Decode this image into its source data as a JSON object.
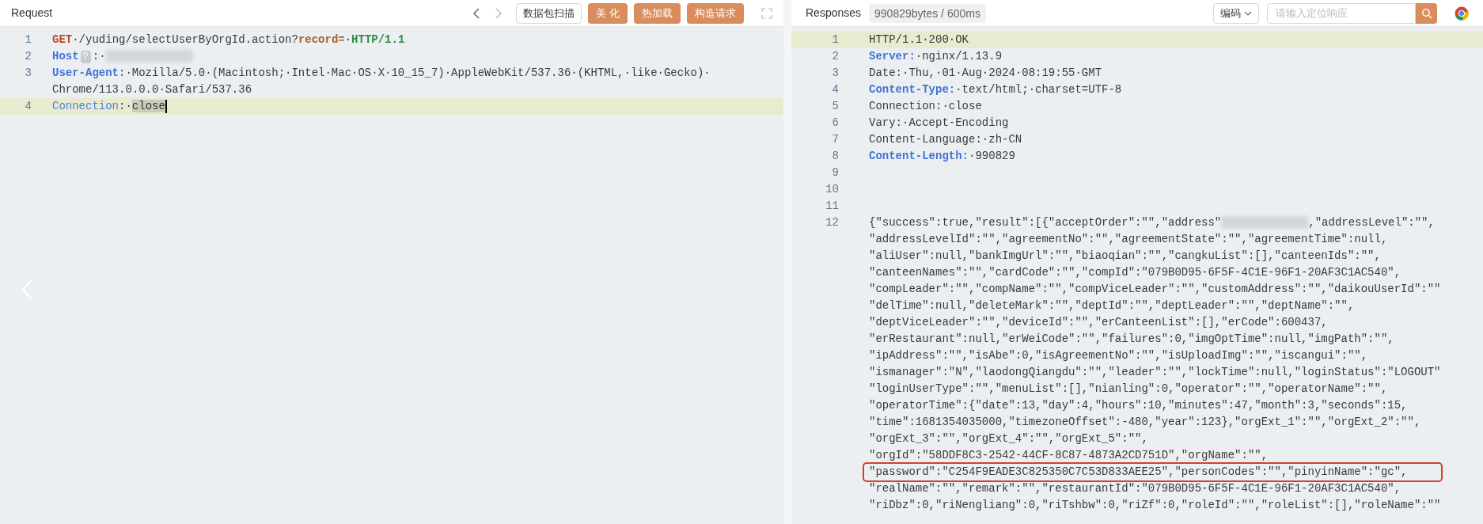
{
  "request": {
    "title": "Request",
    "buttons": [
      {
        "label": "数据包扫描",
        "kind": "outline"
      },
      {
        "label": "美 化",
        "kind": "primary"
      },
      {
        "label": "热加载",
        "kind": "primary"
      },
      {
        "label": "构造请求",
        "kind": "primary"
      }
    ],
    "lines": [
      {
        "number": "1",
        "current": false,
        "rows": [
          {
            "segments": [
              {
                "text": "GET",
                "kind": "method"
              },
              {
                "text": "·/yuding/selectUserByOrgId.action?",
                "kind": "plain"
              },
              {
                "text": "record=",
                "kind": "param"
              },
              {
                "text": "·",
                "kind": "plain"
              },
              {
                "text": "HTTP/1.1",
                "kind": "version"
              }
            ]
          }
        ]
      },
      {
        "number": "2",
        "current": false,
        "rows": [
          {
            "segments": [
              {
                "text": "Host",
                "kind": "key"
              },
              {
                "text": "?",
                "kind": "badge"
              },
              {
                "text": ":·",
                "kind": "plain"
              },
              {
                "kind": "redacted"
              }
            ]
          }
        ]
      },
      {
        "number": "3",
        "current": false,
        "rows": [
          {
            "segments": [
              {
                "text": "User-Agent",
                "kind": "key"
              },
              {
                "text": ":·Mozilla/5.0·(Macintosh;·Intel·Mac·OS·X·10_15_7)·AppleWebKit/537.36·(KHTML,·like·Gecko)·",
                "kind": "plain"
              }
            ]
          },
          {
            "segments": [
              {
                "text": "Chrome/113.0.0.0·Safari/537.36",
                "kind": "plain"
              }
            ]
          }
        ]
      },
      {
        "number": "4",
        "current": true,
        "rows": [
          {
            "segments": [
              {
                "text": "Connection",
                "kind": "keylight"
              },
              {
                "text": ":·",
                "kind": "plain"
              },
              {
                "text": "close",
                "kind": "selected"
              },
              {
                "kind": "cursor"
              }
            ]
          }
        ]
      }
    ]
  },
  "response": {
    "title": "Responses",
    "stats": "990829bytes / 600ms",
    "encoding": "编码",
    "search": {
      "placeholder": "请输入定位响应"
    },
    "lines": [
      {
        "number": "1",
        "current": true,
        "rows": [
          {
            "segments": [
              {
                "text": "HTTP/1.1·200·OK",
                "kind": "plain"
              }
            ]
          }
        ]
      },
      {
        "number": "2",
        "current": false,
        "rows": [
          {
            "segments": [
              {
                "text": "Server:",
                "kind": "key"
              },
              {
                "text": "·nginx/1.13.9",
                "kind": "plain"
              }
            ]
          }
        ]
      },
      {
        "number": "3",
        "current": false,
        "rows": [
          {
            "segments": [
              {
                "text": "Date:·Thu,·01·Aug·2024·08:19:55·GMT",
                "kind": "plain"
              }
            ]
          }
        ]
      },
      {
        "number": "4",
        "current": false,
        "rows": [
          {
            "segments": [
              {
                "text": "Content-Type:",
                "kind": "key"
              },
              {
                "text": "·text/html;·charset=UTF-8",
                "kind": "plain"
              }
            ]
          }
        ]
      },
      {
        "number": "5",
        "current": false,
        "rows": [
          {
            "segments": [
              {
                "text": "Connection:·close",
                "kind": "plain"
              }
            ]
          }
        ]
      },
      {
        "number": "6",
        "current": false,
        "rows": [
          {
            "segments": [
              {
                "text": "Vary:·Accept-Encoding",
                "kind": "plain"
              }
            ]
          }
        ]
      },
      {
        "number": "7",
        "current": false,
        "rows": [
          {
            "segments": [
              {
                "text": "Content-Language:·zh-CN",
                "kind": "plain"
              }
            ]
          }
        ]
      },
      {
        "number": "8",
        "current": false,
        "rows": [
          {
            "segments": [
              {
                "text": "Content-Length:",
                "kind": "key"
              },
              {
                "text": "·990829",
                "kind": "plain"
              }
            ]
          }
        ]
      },
      {
        "number": "9",
        "current": false,
        "rows": [
          {
            "segments": []
          }
        ]
      },
      {
        "number": "10",
        "current": false,
        "rows": [
          {
            "segments": []
          }
        ]
      },
      {
        "number": "11",
        "current": false,
        "rows": [
          {
            "segments": []
          }
        ]
      },
      {
        "number": "12",
        "current": false,
        "rows": [
          {
            "boxed": false,
            "segments": [
              {
                "text": "{\"success\":true,\"result\":[{\"acceptOrder\":\"\",\"address\"",
                "kind": "plain"
              },
              {
                "kind": "redacted"
              },
              {
                "text": ",\"addressLevel\":\"\",",
                "kind": "plain"
              }
            ]
          },
          {
            "boxed": false,
            "segments": [
              {
                "text": "\"addressLevelId\":\"\",\"agreementNo\":\"\",\"agreementState\":\"\",\"agreementTime\":null,",
                "kind": "plain"
              }
            ]
          },
          {
            "boxed": false,
            "segments": [
              {
                "text": "\"aliUser\":null,\"bankImgUrl\":\"\",\"biaoqian\":\"\",\"cangkuList\":[],\"canteenIds\":\"\",",
                "kind": "plain"
              }
            ]
          },
          {
            "boxed": false,
            "segments": [
              {
                "text": "\"canteenNames\":\"\",\"cardCode\":\"\",\"compId\":\"079B0D95-6F5F-4C1E-96F1-20AF3C1AC540\",",
                "kind": "plain"
              }
            ]
          },
          {
            "boxed": false,
            "segments": [
              {
                "text": "\"compLeader\":\"\",\"compName\":\"\",\"compViceLeader\":\"\",\"customAddress\":\"\",\"daikouUserId\":\"\"",
                "kind": "plain"
              }
            ]
          },
          {
            "boxed": false,
            "segments": [
              {
                "text": "\"delTime\":null,\"deleteMark\":\"\",\"deptId\":\"\",\"deptLeader\":\"\",\"deptName\":\"\",",
                "kind": "plain"
              }
            ]
          },
          {
            "boxed": false,
            "segments": [
              {
                "text": "\"deptViceLeader\":\"\",\"deviceId\":\"\",\"erCanteenList\":[],\"erCode\":600437,",
                "kind": "plain"
              }
            ]
          },
          {
            "boxed": false,
            "segments": [
              {
                "text": "\"erRestaurant\":null,\"erWeiCode\":\"\",\"failures\":0,\"imgOptTime\":null,\"imgPath\":\"\",",
                "kind": "plain"
              }
            ]
          },
          {
            "boxed": false,
            "segments": [
              {
                "text": "\"ipAddress\":\"\",\"isAbe\":0,\"isAgreementNo\":\"\",\"isUploadImg\":\"\",\"iscangui\":\"\",",
                "kind": "plain"
              }
            ]
          },
          {
            "boxed": false,
            "segments": [
              {
                "text": "\"ismanager\":\"N\",\"laodongQiangdu\":\"\",\"leader\":\"\",\"lockTime\":null,\"loginStatus\":\"LOGOUT\"",
                "kind": "plain"
              }
            ]
          },
          {
            "boxed": false,
            "segments": [
              {
                "text": "\"loginUserType\":\"\",\"menuList\":[],\"nianling\":0,\"operator\":\"\",\"operatorName\":\"\",",
                "kind": "plain"
              }
            ]
          },
          {
            "boxed": false,
            "segments": [
              {
                "text": "\"operatorTime\":{\"date\":13,\"day\":4,\"hours\":10,\"minutes\":47,\"month\":3,\"seconds\":15,",
                "kind": "plain"
              }
            ]
          },
          {
            "boxed": false,
            "segments": [
              {
                "text": "\"time\":1681354035000,\"timezoneOffset\":-480,\"year\":123},\"orgExt_1\":\"\",\"orgExt_2\":\"\",",
                "kind": "plain"
              }
            ]
          },
          {
            "boxed": false,
            "segments": [
              {
                "text": "\"orgExt_3\":\"\",\"orgExt_4\":\"\",\"orgExt_5\":\"\",",
                "kind": "plain"
              }
            ]
          },
          {
            "boxed": false,
            "segments": [
              {
                "text": "\"orgId\":\"58DDF8C3-2542-44CF-8C87-4873A2CD751D\",\"orgName\":\"\",",
                "kind": "plain"
              }
            ]
          },
          {
            "boxed": true,
            "segments": [
              {
                "text": "\"password\":\"C254F9EADE3C825350C7C53D833AEE25\",\"personCodes\":\"\",\"pinyinName\":\"gc\",",
                "kind": "plain"
              }
            ]
          },
          {
            "boxed": false,
            "segments": [
              {
                "text": "\"realName\":\"\",\"remark\":\"\",\"restaurantId\":\"079B0D95-6F5F-4C1E-96F1-20AF3C1AC540\",",
                "kind": "plain"
              }
            ]
          },
          {
            "boxed": false,
            "segments": [
              {
                "text": "\"riDbz\":0,\"riNengliang\":0,\"riTshbw\":0,\"riZf\":0,\"roleId\":\"\",\"roleList\":[],\"roleName\":\"\"",
                "kind": "plain"
              }
            ]
          }
        ]
      }
    ]
  }
}
